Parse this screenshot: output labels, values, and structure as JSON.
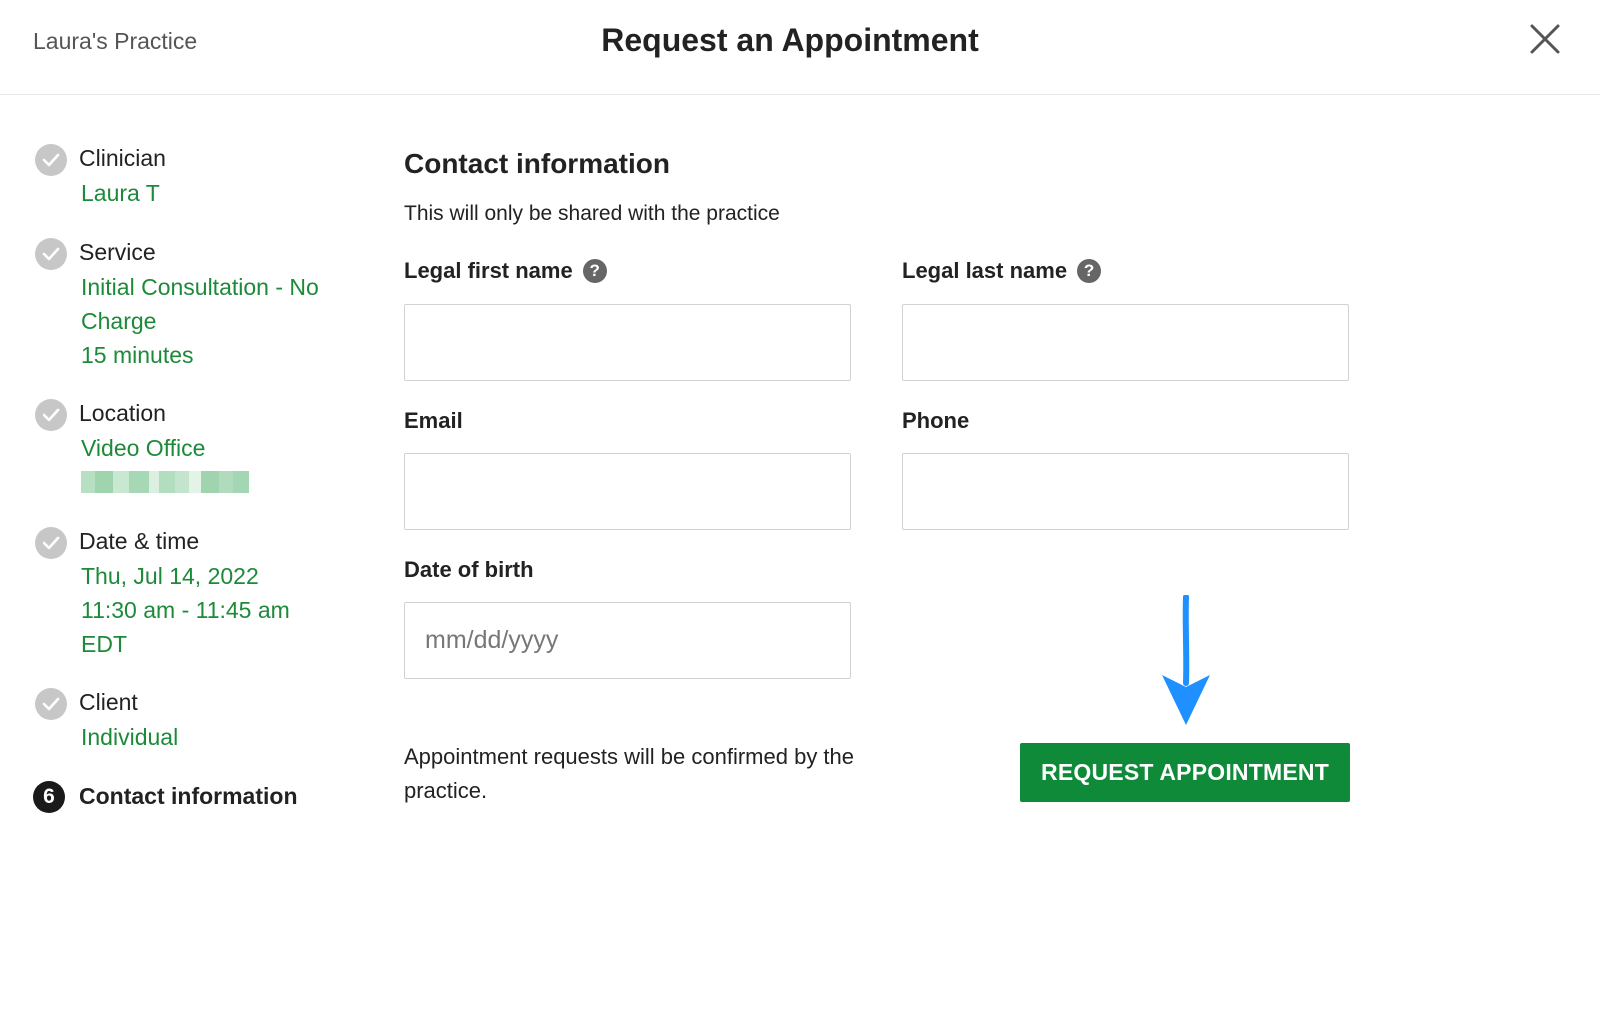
{
  "header": {
    "practice_name": "Laura's Practice",
    "title": "Request an Appointment"
  },
  "steps": [
    {
      "label": "Clinician",
      "values": [
        "Laura T"
      ]
    },
    {
      "label": "Service",
      "values": [
        "Initial Consultation - No",
        "Charge",
        "15 minutes"
      ]
    },
    {
      "label": "Location",
      "values": [
        "Video Office"
      ]
    },
    {
      "label": "Date & time",
      "values": [
        "Thu, Jul 14, 2022",
        "11:30 am - 11:45 am",
        "EDT"
      ]
    },
    {
      "label": "Client",
      "values": [
        "Individual"
      ]
    },
    {
      "number": "6",
      "label": "Contact information"
    }
  ],
  "form": {
    "heading": "Contact information",
    "subtitle": "This will only be shared with the practice",
    "first_name_label": "Legal first name",
    "last_name_label": "Legal last name",
    "help_glyph": "?",
    "email_label": "Email",
    "phone_label": "Phone",
    "dob_label": "Date of birth",
    "dob_placeholder": "mm/dd/yyyy",
    "note": "Appointment requests will be confirmed by the practice.",
    "submit_label": "REQUEST APPOINTMENT"
  },
  "colors": {
    "accent_green": "#1d8a3a",
    "button_green": "#0e8a38",
    "arrow_blue": "#1e90ff"
  }
}
